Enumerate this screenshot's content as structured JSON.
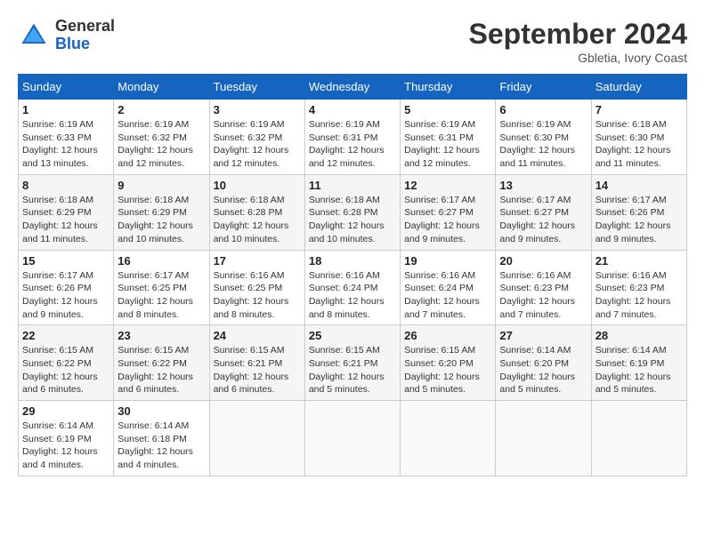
{
  "header": {
    "logo_general": "General",
    "logo_blue": "Blue",
    "month_title": "September 2024",
    "location": "Gbletia, Ivory Coast"
  },
  "weekdays": [
    "Sunday",
    "Monday",
    "Tuesday",
    "Wednesday",
    "Thursday",
    "Friday",
    "Saturday"
  ],
  "weeks": [
    [
      {
        "day": "1",
        "sunrise": "6:19 AM",
        "sunset": "6:33 PM",
        "daylight": "12 hours and 13 minutes."
      },
      {
        "day": "2",
        "sunrise": "6:19 AM",
        "sunset": "6:32 PM",
        "daylight": "12 hours and 12 minutes."
      },
      {
        "day": "3",
        "sunrise": "6:19 AM",
        "sunset": "6:32 PM",
        "daylight": "12 hours and 12 minutes."
      },
      {
        "day": "4",
        "sunrise": "6:19 AM",
        "sunset": "6:31 PM",
        "daylight": "12 hours and 12 minutes."
      },
      {
        "day": "5",
        "sunrise": "6:19 AM",
        "sunset": "6:31 PM",
        "daylight": "12 hours and 12 minutes."
      },
      {
        "day": "6",
        "sunrise": "6:19 AM",
        "sunset": "6:30 PM",
        "daylight": "12 hours and 11 minutes."
      },
      {
        "day": "7",
        "sunrise": "6:18 AM",
        "sunset": "6:30 PM",
        "daylight": "12 hours and 11 minutes."
      }
    ],
    [
      {
        "day": "8",
        "sunrise": "6:18 AM",
        "sunset": "6:29 PM",
        "daylight": "12 hours and 11 minutes."
      },
      {
        "day": "9",
        "sunrise": "6:18 AM",
        "sunset": "6:29 PM",
        "daylight": "12 hours and 10 minutes."
      },
      {
        "day": "10",
        "sunrise": "6:18 AM",
        "sunset": "6:28 PM",
        "daylight": "12 hours and 10 minutes."
      },
      {
        "day": "11",
        "sunrise": "6:18 AM",
        "sunset": "6:28 PM",
        "daylight": "12 hours and 10 minutes."
      },
      {
        "day": "12",
        "sunrise": "6:17 AM",
        "sunset": "6:27 PM",
        "daylight": "12 hours and 9 minutes."
      },
      {
        "day": "13",
        "sunrise": "6:17 AM",
        "sunset": "6:27 PM",
        "daylight": "12 hours and 9 minutes."
      },
      {
        "day": "14",
        "sunrise": "6:17 AM",
        "sunset": "6:26 PM",
        "daylight": "12 hours and 9 minutes."
      }
    ],
    [
      {
        "day": "15",
        "sunrise": "6:17 AM",
        "sunset": "6:26 PM",
        "daylight": "12 hours and 9 minutes."
      },
      {
        "day": "16",
        "sunrise": "6:17 AM",
        "sunset": "6:25 PM",
        "daylight": "12 hours and 8 minutes."
      },
      {
        "day": "17",
        "sunrise": "6:16 AM",
        "sunset": "6:25 PM",
        "daylight": "12 hours and 8 minutes."
      },
      {
        "day": "18",
        "sunrise": "6:16 AM",
        "sunset": "6:24 PM",
        "daylight": "12 hours and 8 minutes."
      },
      {
        "day": "19",
        "sunrise": "6:16 AM",
        "sunset": "6:24 PM",
        "daylight": "12 hours and 7 minutes."
      },
      {
        "day": "20",
        "sunrise": "6:16 AM",
        "sunset": "6:23 PM",
        "daylight": "12 hours and 7 minutes."
      },
      {
        "day": "21",
        "sunrise": "6:16 AM",
        "sunset": "6:23 PM",
        "daylight": "12 hours and 7 minutes."
      }
    ],
    [
      {
        "day": "22",
        "sunrise": "6:15 AM",
        "sunset": "6:22 PM",
        "daylight": "12 hours and 6 minutes."
      },
      {
        "day": "23",
        "sunrise": "6:15 AM",
        "sunset": "6:22 PM",
        "daylight": "12 hours and 6 minutes."
      },
      {
        "day": "24",
        "sunrise": "6:15 AM",
        "sunset": "6:21 PM",
        "daylight": "12 hours and 6 minutes."
      },
      {
        "day": "25",
        "sunrise": "6:15 AM",
        "sunset": "6:21 PM",
        "daylight": "12 hours and 5 minutes."
      },
      {
        "day": "26",
        "sunrise": "6:15 AM",
        "sunset": "6:20 PM",
        "daylight": "12 hours and 5 minutes."
      },
      {
        "day": "27",
        "sunrise": "6:14 AM",
        "sunset": "6:20 PM",
        "daylight": "12 hours and 5 minutes."
      },
      {
        "day": "28",
        "sunrise": "6:14 AM",
        "sunset": "6:19 PM",
        "daylight": "12 hours and 5 minutes."
      }
    ],
    [
      {
        "day": "29",
        "sunrise": "6:14 AM",
        "sunset": "6:19 PM",
        "daylight": "12 hours and 4 minutes."
      },
      {
        "day": "30",
        "sunrise": "6:14 AM",
        "sunset": "6:18 PM",
        "daylight": "12 hours and 4 minutes."
      },
      null,
      null,
      null,
      null,
      null
    ]
  ]
}
